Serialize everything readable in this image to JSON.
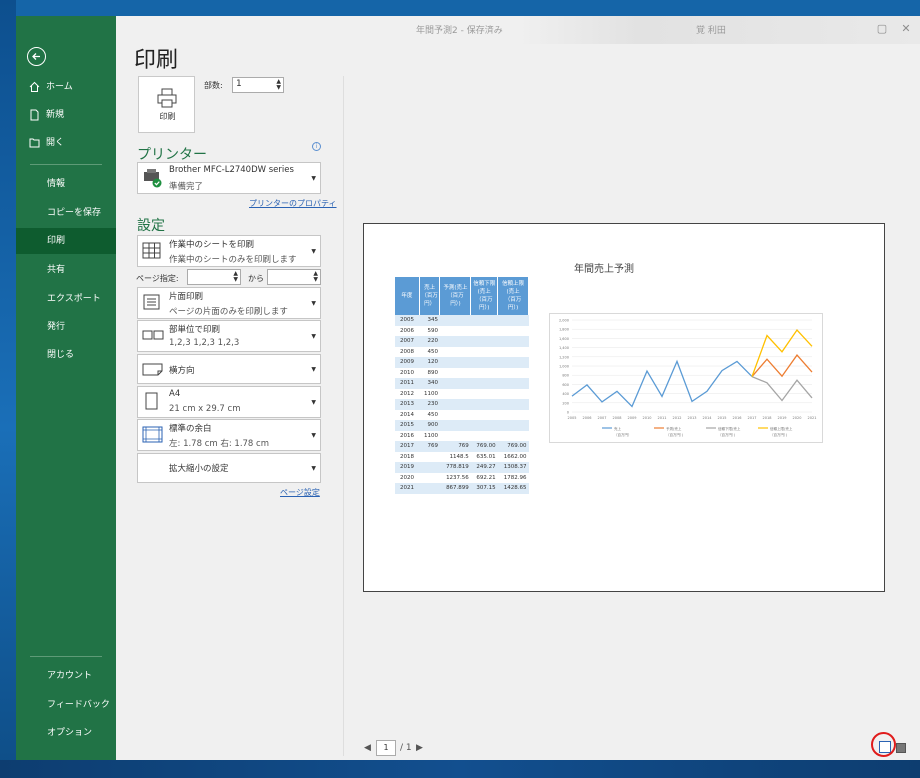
{
  "titlebar": {
    "title": "年間予測2 - 保存済み",
    "user": "覚 利田"
  },
  "sidebar": {
    "top_items": [
      {
        "label": "ホーム",
        "icon": "home-icon"
      },
      {
        "label": "新規",
        "icon": "new-document-icon"
      },
      {
        "label": "開く",
        "icon": "folder-open-icon"
      }
    ],
    "sub_items": [
      "情報",
      "コピーを保存",
      "印刷",
      "共有",
      "エクスポート",
      "発行",
      "閉じる"
    ],
    "selected": "印刷",
    "bottom_items": [
      "アカウント",
      "フィードバック",
      "オプション"
    ]
  },
  "print": {
    "heading": "印刷",
    "button_label": "印刷",
    "copies_label": "部数:",
    "copies_value": "1"
  },
  "printer": {
    "heading": "プリンター",
    "name": "Brother MFC-L2740DW series",
    "status": "準備完了",
    "properties_link": "プリンターのプロパティ"
  },
  "settings": {
    "heading": "設定",
    "scope": {
      "title": "作業中のシートを印刷",
      "desc": "作業中のシートのみを印刷します"
    },
    "pages_label": "ページ指定:",
    "pages_to": "から",
    "sides": {
      "title": "片面印刷",
      "desc": "ページの片面のみを印刷します"
    },
    "collate": {
      "title": "部単位で印刷",
      "desc": "1,2,3    1,2,3    1,2,3"
    },
    "orientation": "横方向",
    "paper": {
      "title": "A4",
      "desc": "21 cm x 29.7 cm"
    },
    "margins": {
      "title": "標準の余白",
      "desc": "左:  1.78 cm    右:  1.78 cm"
    },
    "scaling": "拡大縮小の設定",
    "page_setup_link": "ページ設定"
  },
  "preview": {
    "chart_title": "年間売上予測",
    "table_headers": [
      "年度",
      "売上\n（百万\n円）",
      "予測(売上\n（百万\n円）)",
      "信頼下限\n(売上\n（百万\n円）)",
      "信頼上限\n(売上\n（百万\n円）)"
    ],
    "rows": [
      [
        "2005",
        "345",
        "",
        "",
        ""
      ],
      [
        "2006",
        "590",
        "",
        "",
        ""
      ],
      [
        "2007",
        "220",
        "",
        "",
        ""
      ],
      [
        "2008",
        "450",
        "",
        "",
        ""
      ],
      [
        "2009",
        "120",
        "",
        "",
        ""
      ],
      [
        "2010",
        "890",
        "",
        "",
        ""
      ],
      [
        "2011",
        "340",
        "",
        "",
        ""
      ],
      [
        "2012",
        "1100",
        "",
        "",
        ""
      ],
      [
        "2013",
        "230",
        "",
        "",
        ""
      ],
      [
        "2014",
        "450",
        "",
        "",
        ""
      ],
      [
        "2015",
        "900",
        "",
        "",
        ""
      ],
      [
        "2016",
        "1100",
        "",
        "",
        ""
      ],
      [
        "2017",
        "769",
        "769",
        "769.00",
        "769.00"
      ],
      [
        "2018",
        "",
        "1148.5",
        "635.01",
        "1662.00"
      ],
      [
        "2019",
        "",
        "778.819",
        "249.27",
        "1308.37"
      ],
      [
        "2020",
        "",
        "1237.56",
        "692.21",
        "1782.96"
      ],
      [
        "2021",
        "",
        "867.899",
        "307.15",
        "1428.65"
      ]
    ],
    "page_current": "1",
    "page_total": "/ 1"
  },
  "chart_data": {
    "type": "line",
    "title": "",
    "x": [
      "2005",
      "2006",
      "2007",
      "2008",
      "2009",
      "2010",
      "2011",
      "2012",
      "2013",
      "2014",
      "2015",
      "2016",
      "2017",
      "2018",
      "2019",
      "2020",
      "2021"
    ],
    "ylim": [
      0,
      2000
    ],
    "yticks": [
      "0",
      "200",
      "400",
      "600",
      "800",
      "1,000",
      "1,200",
      "1,400",
      "1,600",
      "1,800",
      "2,000"
    ],
    "series": [
      {
        "name": "売上\n（百万円）",
        "color": "#5b9bd5",
        "values": [
          345,
          590,
          220,
          450,
          120,
          890,
          340,
          1100,
          230,
          450,
          900,
          1100,
          769,
          null,
          null,
          null,
          null
        ]
      },
      {
        "name": "予測(売上\n（百万円）)",
        "color": "#ed7d31",
        "values": [
          null,
          null,
          null,
          null,
          null,
          null,
          null,
          null,
          null,
          null,
          null,
          null,
          769,
          1148.5,
          778.819,
          1237.56,
          867.899
        ]
      },
      {
        "name": "信頼下限(売上\n（百万円）)",
        "color": "#a5a5a5",
        "values": [
          null,
          null,
          null,
          null,
          null,
          null,
          null,
          null,
          null,
          null,
          null,
          null,
          769,
          635.01,
          249.27,
          692.21,
          307.15
        ]
      },
      {
        "name": "信頼上限(売上\n（百万円）)",
        "color": "#ffc000",
        "values": [
          null,
          null,
          null,
          null,
          null,
          null,
          null,
          null,
          null,
          null,
          null,
          null,
          769,
          1662.0,
          1308.37,
          1782.96,
          1428.65
        ]
      }
    ],
    "grid": true,
    "legend": "bottom"
  }
}
